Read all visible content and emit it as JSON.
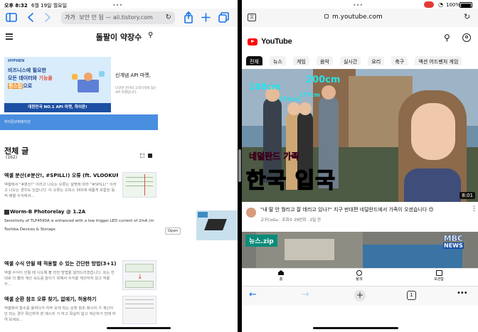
{
  "status_left": {
    "time": "오후 8:32",
    "date": "6월 19일 월요일"
  },
  "status_right": {
    "battery": "100%"
  },
  "left_browser": {
    "address_prefix": "가가",
    "address_text": "보안 안 됨 — ali.tistory.com",
    "blog_title": "돌팔이 약장수",
    "ad": {
      "brand": "HYPHEN",
      "line1a": "비즈니스에 필요한",
      "line2a": "모든 데이터와 ",
      "line2b": "기능을",
      "line3a": "원스탑",
      "line3b": "으로",
      "bottom": "대한민국 NO.1 API 마켓, 하이픈!",
      "side_title": "신개념 API 마켓, ",
      "side_desc": "다양한 분야의 고객기자에 맞는 API 마켓입니다.",
      "bar_text": "하이픈코퍼레이션"
    },
    "section_title": "전체 글",
    "section_count": "(162)",
    "posts": [
      {
        "title": "엑셀 분산(#분산!, #SPILL!) 오류 (ft. VLOOKUP)",
        "excerpt": "엑셀에서 \"#분산!\" 이라고 나오는 오류는 설명에 따라 \"#SPILL!\" 이라고 나오는 경우도 있습니다. 이 오류는 오피스 365에 새롭게 포함된 동적 배열 수식에서..."
      },
      {
        "title": "엑셀 수식 안될 때 적용할 수 있는 간단한 방법(3+1)",
        "excerpt": "엑셀 수식이 안될 때 시도해 볼 만한 방법을 알려드리겠습니다. 또는 반대로 더 빨리 계산 속도를 높이기 위해서 수식을 계산하지 않고 적을 수..."
      },
      {
        "title": "엑셀 순환 참조 오류 찾기, 없애기, 허용하기",
        "excerpt": "엑셀에서 함수를 용하다가 자주 보게 되는 순환 참조 메시지 가 계산이 안 되는 경우 확인하여 본 메시지 가 하고 확실히 알고 계산하기 전에 하여 보세요..."
      }
    ],
    "inline_ad": {
      "title": "Worm-B Photorelay ",
      "title_suffix": "@ 1.2A",
      "desc": "Sensitivity of TLP4590A is enhanced with a low trigger LED current of 2mA (max)",
      "company": "Toshiba Devices & Storage",
      "open_label": "Open"
    }
  },
  "right_browser": {
    "url": "m.youtube.com",
    "logo_text": "YouTube",
    "chips": [
      "전체",
      "뉴스",
      "게임",
      "음악",
      "실시간",
      "요리",
      "축구",
      "액션 어드벤처 게임"
    ],
    "video": {
      "overlay_subtitle": "네덜란드 가족",
      "overlay_title": "한국 입국",
      "h1": "188cm",
      "h2": "200cm",
      "h3": "176cm",
      "h4": "177cm",
      "duration": "8:01",
      "title": "\"내 딸 안 뭘리고 잘 데리고 있나?\" 지구 반대편 네덜란드에서 가족이 오셨습니다 😊",
      "meta": "고구CoGu · 조회수 29만회 · 2일 전"
    },
    "video2": {
      "badge": "뉴스.zip",
      "news_line1": "MBC",
      "news_line2": "NEWS"
    },
    "bottom_nav": [
      "홈",
      "탐색",
      "보관함"
    ],
    "tab_count": "1"
  }
}
